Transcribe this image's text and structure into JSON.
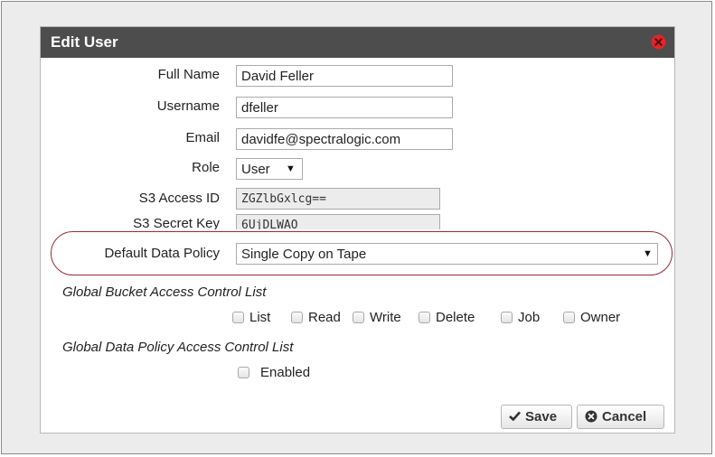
{
  "dialog": {
    "title": "Edit User",
    "close_icon": "close-circle-icon"
  },
  "form": {
    "full_name": {
      "label": "Full Name",
      "value": "David Feller"
    },
    "username": {
      "label": "Username",
      "value": "dfeller"
    },
    "email": {
      "label": "Email",
      "value": "davidfe@spectralogic.com"
    },
    "role": {
      "label": "Role",
      "value": "User",
      "arrow": "▼"
    },
    "s3_access_id": {
      "label": "S3 Access ID",
      "value": "ZGZlbGxlcg=="
    },
    "s3_secret_key": {
      "label": "S3 Secret Key",
      "value": "6UjDLWAO"
    },
    "default_data_policy": {
      "label": "Default Data Policy",
      "value": "Single Copy on Tape",
      "arrow": "▼"
    }
  },
  "bucket_acl": {
    "title": "Global Bucket Access Control List",
    "options": [
      "List",
      "Read",
      "Write",
      "Delete",
      "Job",
      "Owner"
    ]
  },
  "policy_acl": {
    "title": "Global Data Policy Access Control List",
    "enabled_label": "Enabled"
  },
  "buttons": {
    "save": {
      "label": "Save",
      "icon": "check-icon"
    },
    "cancel": {
      "label": "Cancel",
      "icon": "cancel-circle-icon"
    }
  },
  "colors": {
    "titlebar": "#4d4d4d",
    "close_icon": "#e0262b",
    "highlight_outline": "#9b2b31"
  }
}
